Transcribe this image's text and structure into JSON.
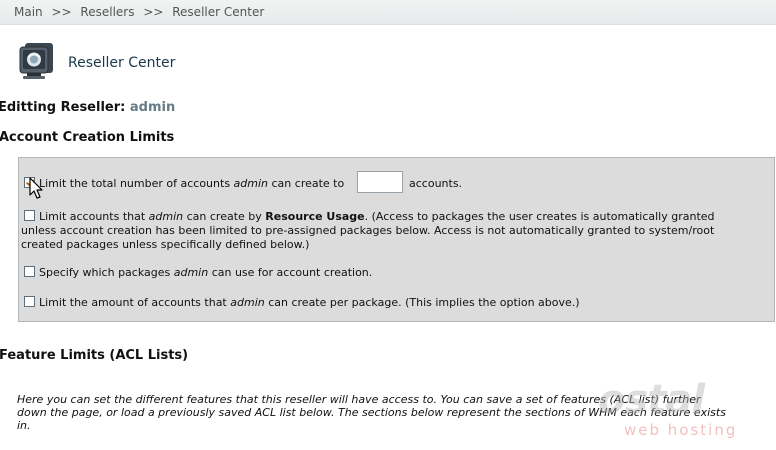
{
  "breadcrumb": {
    "items": [
      "Main",
      "Resellers",
      "Reseller Center"
    ],
    "separator": ">>"
  },
  "header": {
    "title": "Reseller Center",
    "icon": "monitor-icon"
  },
  "editing": {
    "label": "Editting Reseller:",
    "name": "admin"
  },
  "account_limits": {
    "title": "Account Creation Limits",
    "options": [
      {
        "checked": true,
        "pre": "Limit the total number of accounts ",
        "user": "admin",
        "post": " can create to ",
        "suffix": "accounts.",
        "input_value": ""
      },
      {
        "checked": false,
        "pre": "Limit accounts that ",
        "user": "admin",
        "mid": " can create by ",
        "bold": "Resource Usage",
        "post": ". (Access to packages the user creates is automatically granted",
        "line2": "unless account creation has been limited to pre-assigned packages below. Access is not automatically granted to system/root",
        "line3": "created packages unless specifically defined below.)"
      },
      {
        "checked": false,
        "pre": "Specify which packages ",
        "user": "admin",
        "post": " can use for account creation."
      },
      {
        "checked": false,
        "pre": "Limit the amount of accounts that ",
        "user": "admin",
        "post": " can create per package. (This implies the option above.)"
      }
    ]
  },
  "feature_limits": {
    "title": "Feature Limits (ACL Lists)",
    "desc_l1": "Here you can set the different features that this reseller will have access to. You can save a set of features (ACL list) further",
    "desc_l2": "down the page, or load a previously saved ACL list below. The sections below represent the sections of WHM each feature exists",
    "desc_l3": "in."
  },
  "watermark": {
    "brand": "ostal",
    "tagline": "web hosting"
  },
  "colors": {
    "panel": "#dcdcdc",
    "check": "#c46a00",
    "title": "#1a3a4a"
  }
}
